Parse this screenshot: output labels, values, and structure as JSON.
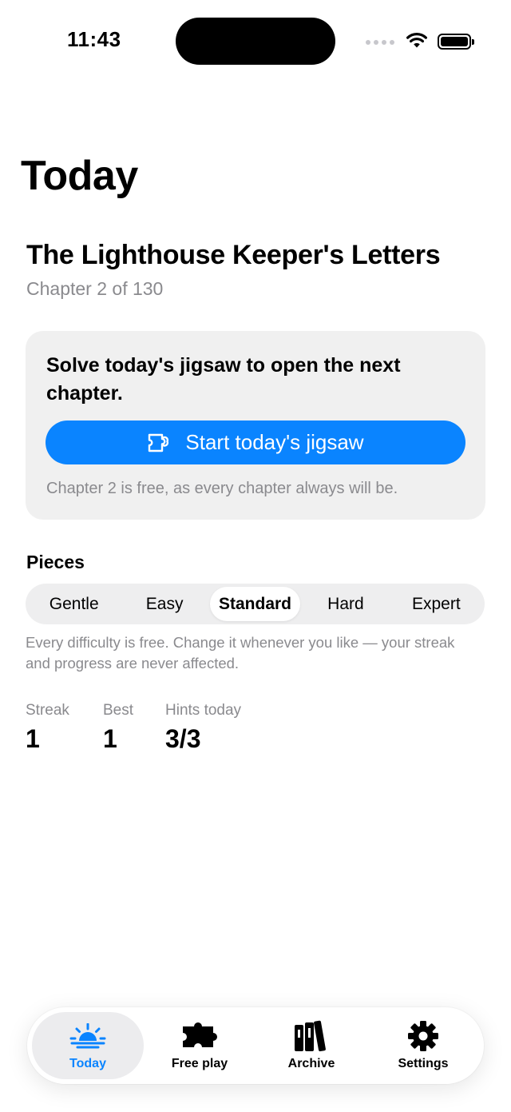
{
  "status_bar": {
    "time": "11:43"
  },
  "page_title": "Today",
  "book": {
    "title": "The Lighthouse Keeper's Letters",
    "chapter": "Chapter 2 of 130"
  },
  "card": {
    "heading": "Solve today's jigsaw to open the next chapter.",
    "button_label": "Start today's jigsaw",
    "note": "Chapter 2 is free, as every chapter always will be."
  },
  "pieces": {
    "label": "Pieces",
    "options": [
      "Gentle",
      "Easy",
      "Standard",
      "Hard",
      "Expert"
    ],
    "selected": "Standard",
    "note": "Every difficulty is free. Change it whenever you like — your streak and progress are never affected."
  },
  "stats": [
    {
      "label": "Streak",
      "value": "1"
    },
    {
      "label": "Best",
      "value": "1"
    },
    {
      "label": "Hints today",
      "value": "3/3"
    }
  ],
  "tabs": [
    {
      "label": "Today",
      "icon": "sunrise-icon",
      "active": true
    },
    {
      "label": "Free play",
      "icon": "puzzle-piece-icon",
      "active": false
    },
    {
      "label": "Archive",
      "icon": "books-icon",
      "active": false
    },
    {
      "label": "Settings",
      "icon": "gear-icon",
      "active": false
    }
  ],
  "colors": {
    "accent": "#0a84ff",
    "secondary_text": "#8a8a8e",
    "card_bg": "#f0f0f0"
  }
}
